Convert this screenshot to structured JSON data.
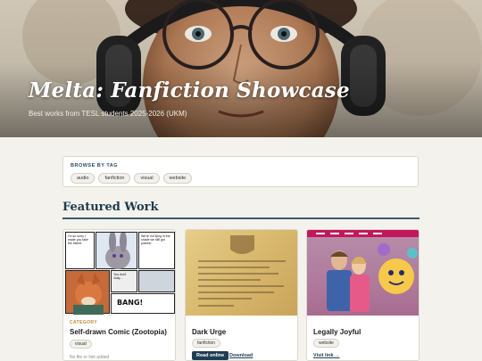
{
  "hero": {
    "title": "Melta: Fanfiction Showcase",
    "subtitle": "Best works from TESL students 2025-2026 (UKM)"
  },
  "browse": {
    "label": "BROWSE BY TAG",
    "tags": [
      "audio",
      "fanfiction",
      "visual",
      "website"
    ]
  },
  "featured": {
    "title": "Featured Work"
  },
  "cards": [
    {
      "category": "CATEGORY",
      "title": "Self-drawn Comic (Zootopia)",
      "tag": "visual",
      "note": "No file or link added",
      "image_text": [
        "I'm so sorry I made you take the blame.",
        "We're not lying in the shade we still got pranks!",
        "You don't Judy...",
        "BANG!"
      ]
    },
    {
      "title": "Dark Urge",
      "tag": "fanfiction",
      "read_label": "Read online",
      "download_label": "Download"
    },
    {
      "title": "Legally Joyful",
      "tag": "website",
      "link_label": "Visit link →"
    }
  ],
  "colors": {
    "accent": "#1f3d52",
    "category": "#c08a3e",
    "background": "#f4f2ec"
  }
}
